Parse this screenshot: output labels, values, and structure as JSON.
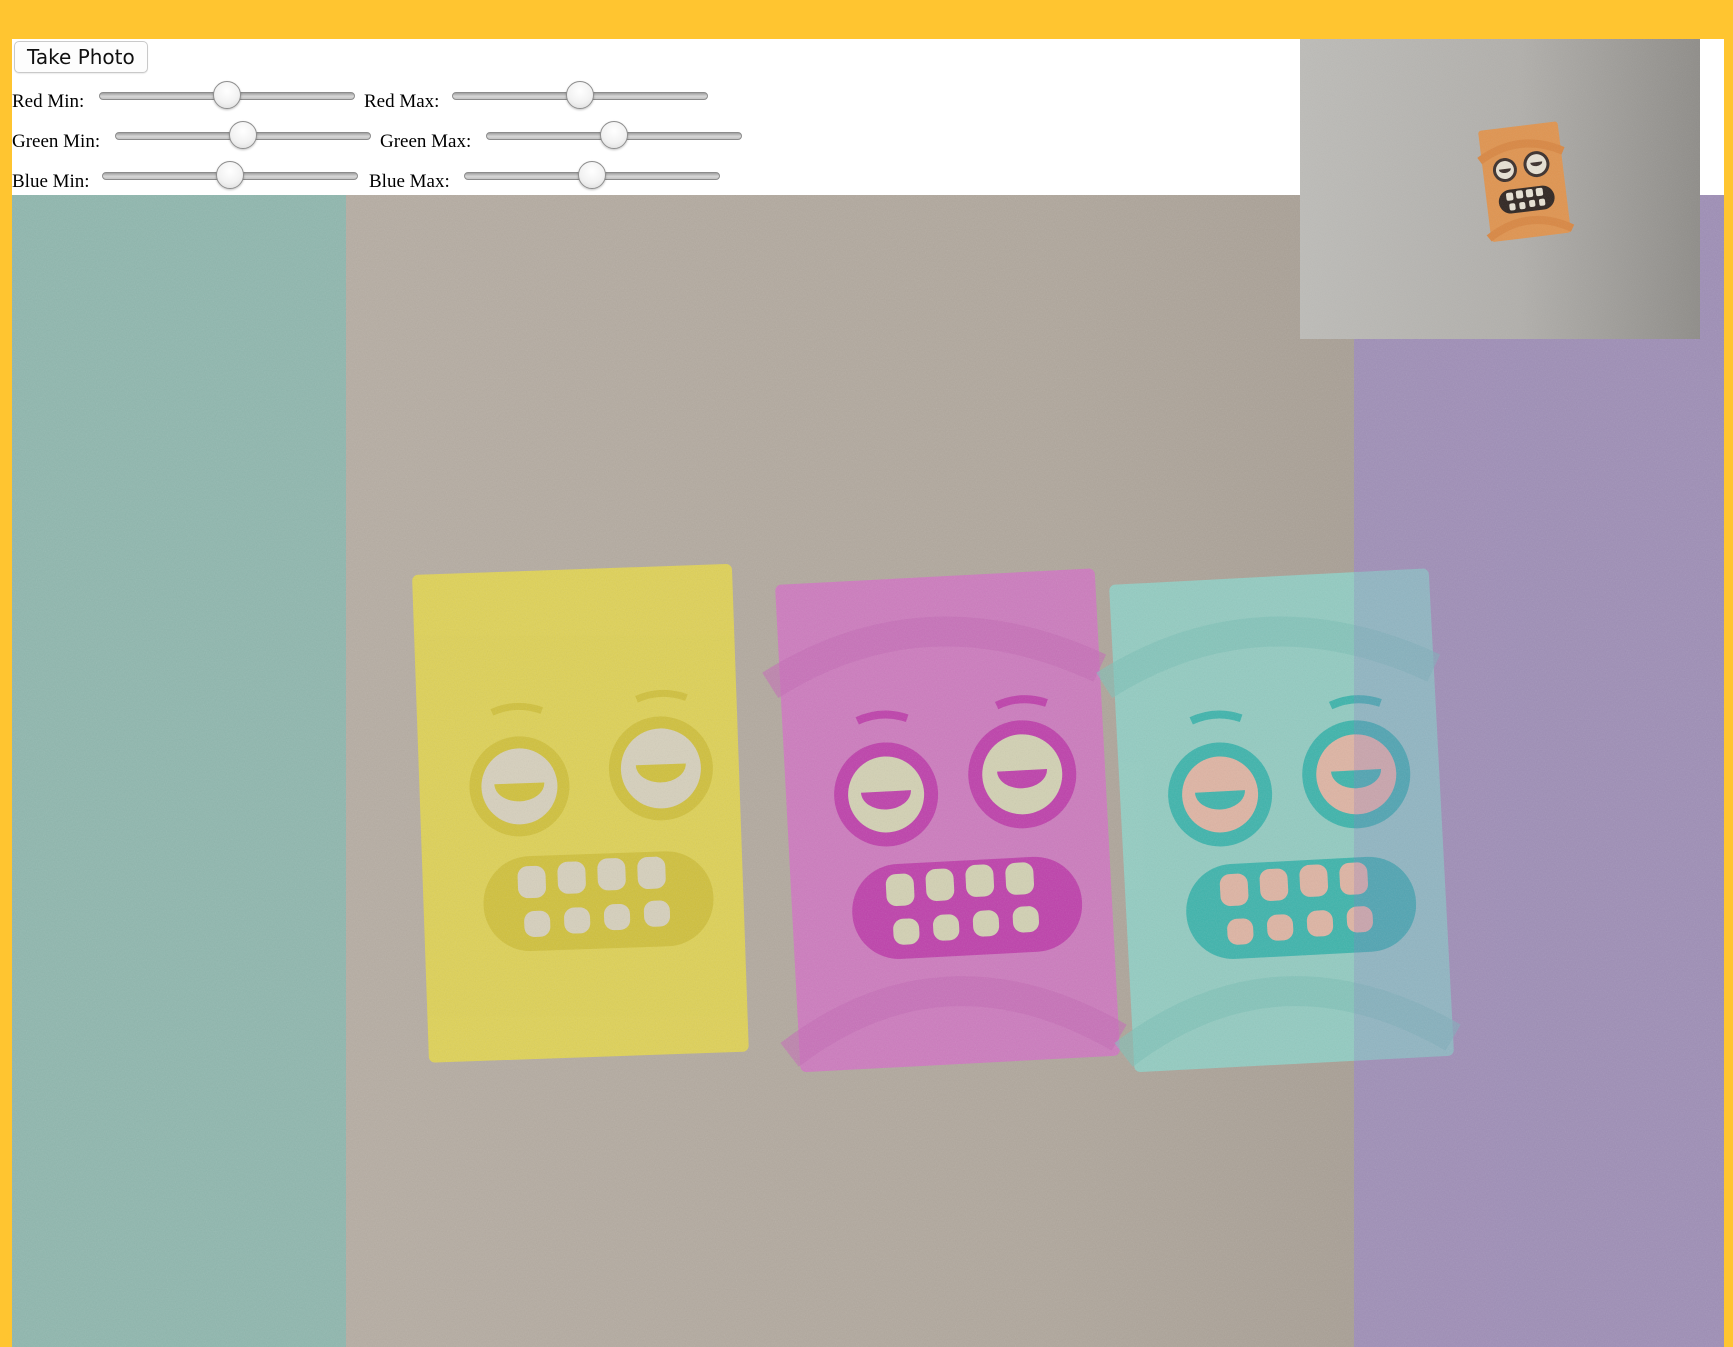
{
  "toolbar": {
    "take_photo_label": "Take Photo"
  },
  "sliders": [
    {
      "id": "red-min",
      "label": "Red Min:",
      "value": 0.5
    },
    {
      "id": "red-max",
      "label": "Red Max:",
      "value": 0.5
    },
    {
      "id": "green-min",
      "label": "Green Min:",
      "value": 0.5
    },
    {
      "id": "green-max",
      "label": "Green Max:",
      "value": 0.5
    },
    {
      "id": "blue-min",
      "label": "Blue Min:",
      "value": 0.5
    },
    {
      "id": "blue-max",
      "label": "Blue Max:",
      "value": 0.5
    }
  ],
  "colors": {
    "page_background": "#ffc530",
    "cyan_strip": "#8fb7ae",
    "wall": "#b4aba0",
    "purple_strip": "#a694bd",
    "yellow_tint": "#e6d84a",
    "magenta_tint": "#d274c4",
    "cyan_tint": "#5cc7c3",
    "preview_card": "#e0944f"
  }
}
